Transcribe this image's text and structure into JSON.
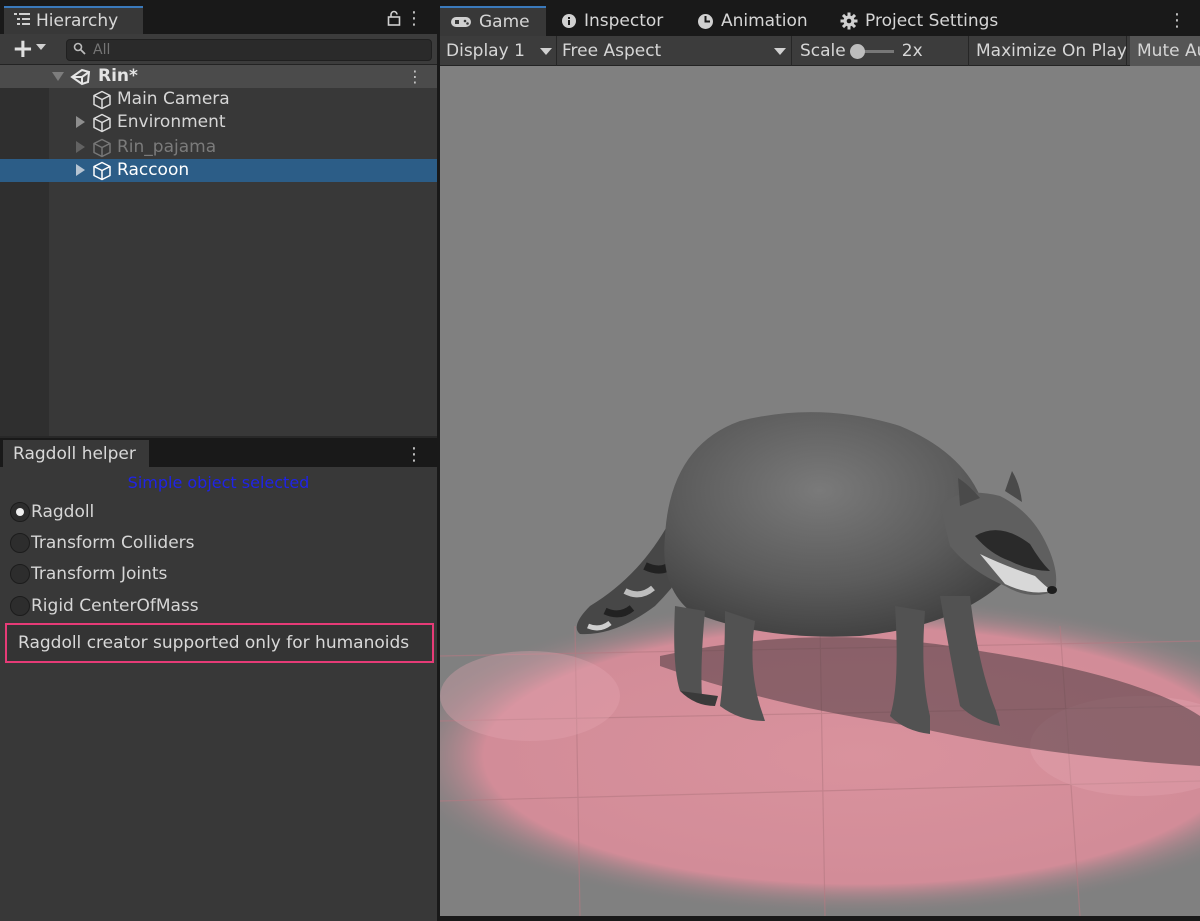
{
  "hierarchy": {
    "tab_label": "Hierarchy",
    "search_placeholder": "All",
    "scene_name": "Rin*",
    "items": [
      {
        "label": "Main Camera",
        "has_children": false,
        "state": "normal"
      },
      {
        "label": "Environment",
        "has_children": true,
        "state": "normal"
      },
      {
        "label": "Rin_pajama",
        "has_children": true,
        "state": "disabled"
      },
      {
        "label": "Raccoon",
        "has_children": true,
        "state": "selected"
      }
    ]
  },
  "ragdoll_helper": {
    "tab_label": "Ragdoll helper",
    "status": "Simple object selected",
    "options": [
      {
        "label": "Ragdoll",
        "selected": true
      },
      {
        "label": "Transform Colliders",
        "selected": false
      },
      {
        "label": "Transform Joints",
        "selected": false
      },
      {
        "label": "Rigid CenterOfMass",
        "selected": false
      }
    ],
    "warning": "Ragdoll creator supported only for humanoids"
  },
  "editor_tabs": {
    "game": "Game",
    "inspector": "Inspector",
    "animation": "Animation",
    "project_settings": "Project Settings"
  },
  "game_toolbar": {
    "display": "Display 1",
    "aspect": "Free Aspect",
    "scale_label": "Scale",
    "scale_value": "2x",
    "maximize": "Maximize On Play",
    "mute": "Mute Audio"
  },
  "colors": {
    "selection": "#2c5d87",
    "tab_accent": "#3a79bb",
    "status_text": "#1f23e6",
    "warning_border": "#e63b77"
  }
}
